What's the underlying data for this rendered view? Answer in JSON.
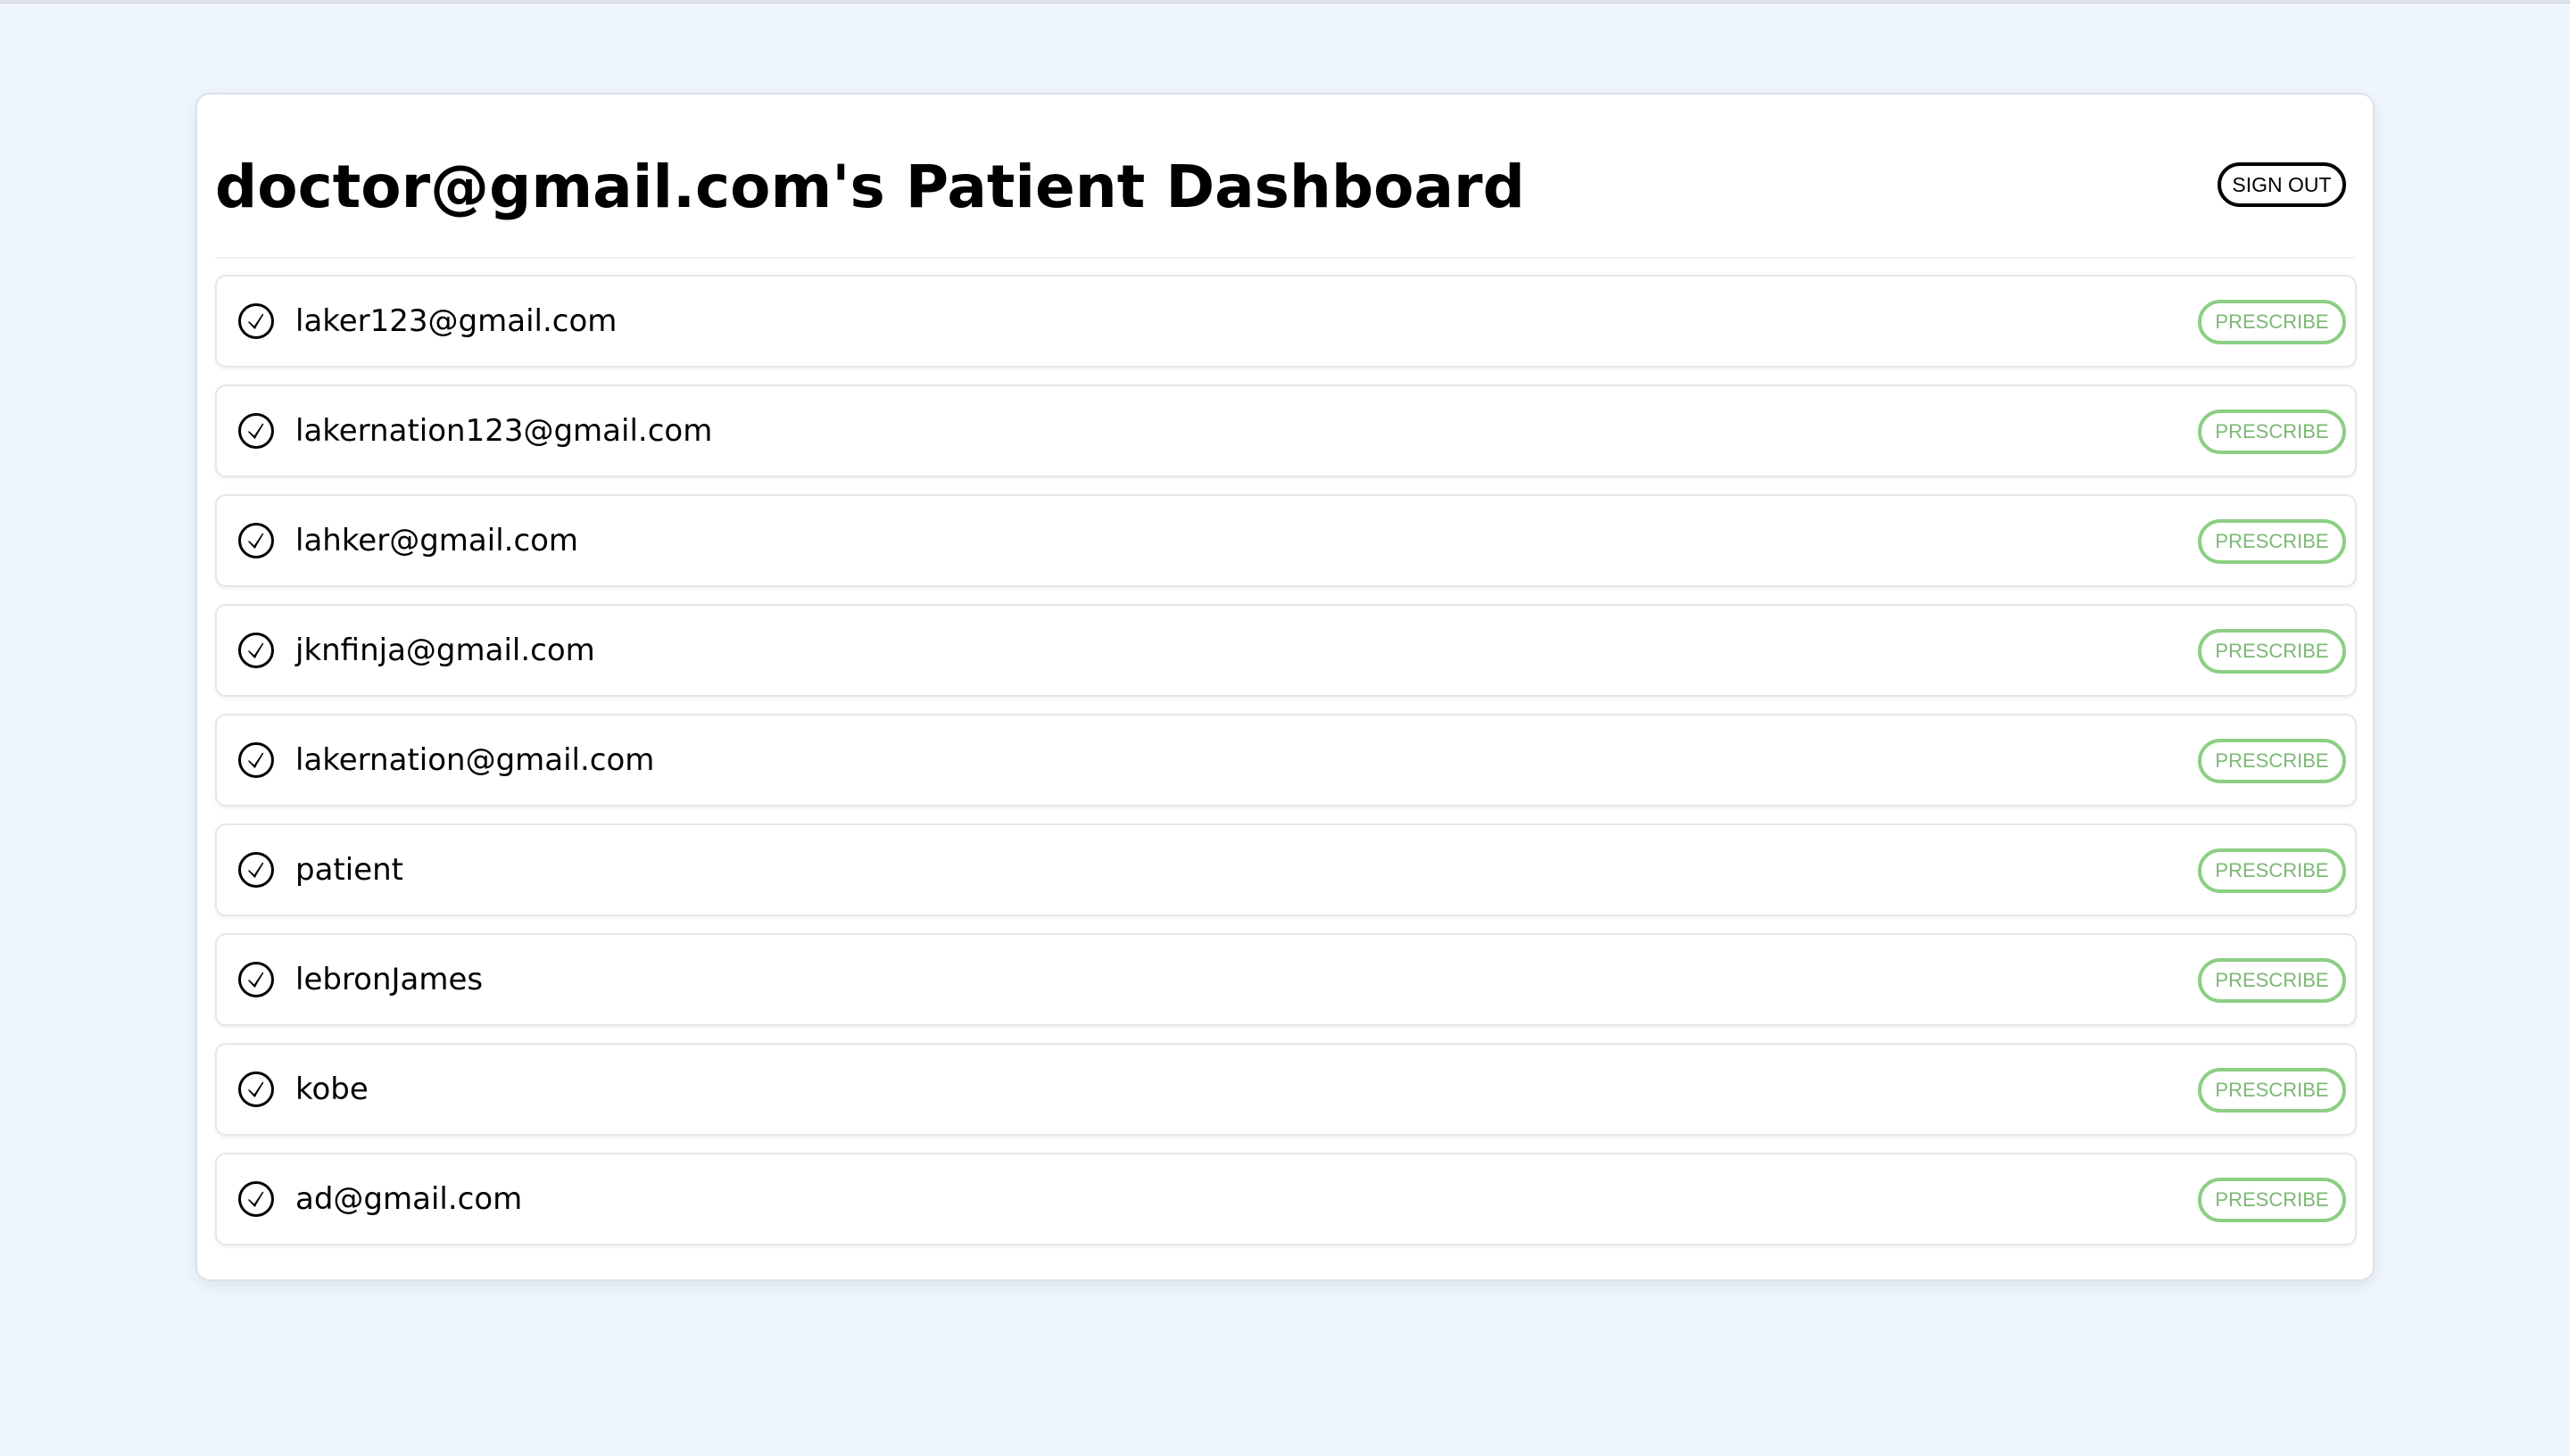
{
  "header": {
    "title": "doctor@gmail.com's Patient Dashboard",
    "sign_out_label": "SIGN OUT"
  },
  "patients": [
    {
      "name": "laker123@gmail.com",
      "action_label": "PRESCRIBE",
      "icon": "check-circle-icon"
    },
    {
      "name": "lakernation123@gmail.com",
      "action_label": "PRESCRIBE",
      "icon": "check-circle-icon"
    },
    {
      "name": "lahker@gmail.com",
      "action_label": "PRESCRIBE",
      "icon": "check-circle-icon"
    },
    {
      "name": "jknfinja@gmail.com",
      "action_label": "PRESCRIBE",
      "icon": "check-circle-icon"
    },
    {
      "name": "lakernation@gmail.com",
      "action_label": "PRESCRIBE",
      "icon": "check-circle-icon"
    },
    {
      "name": "patient",
      "action_label": "PRESCRIBE",
      "icon": "check-circle-icon"
    },
    {
      "name": "lebronJames",
      "action_label": "PRESCRIBE",
      "icon": "check-circle-icon"
    },
    {
      "name": "kobe",
      "action_label": "PRESCRIBE",
      "icon": "check-circle-icon"
    },
    {
      "name": "ad@gmail.com",
      "action_label": "PRESCRIBE",
      "icon": "check-circle-icon"
    }
  ],
  "colors": {
    "page_background": "#eff6fd",
    "prescribe_accent": "#8ccf84",
    "sign_out_border": "#000000"
  }
}
